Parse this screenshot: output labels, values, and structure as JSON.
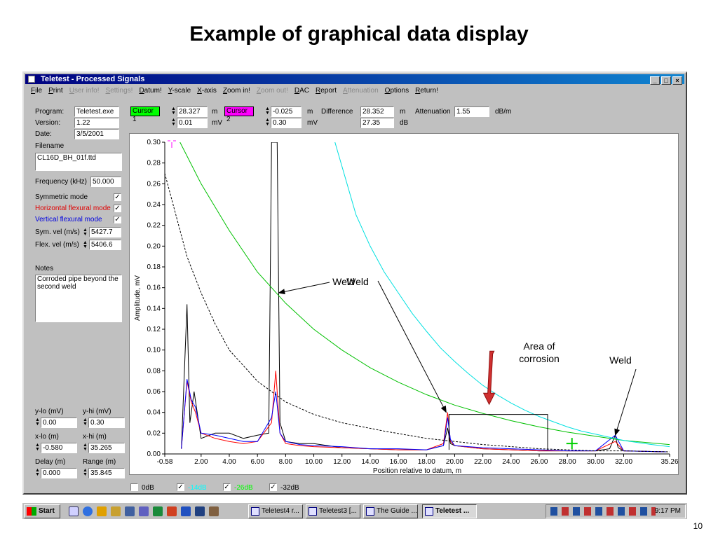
{
  "slide": {
    "title": "Example of graphical data display",
    "number": "10"
  },
  "window": {
    "title": "Teletest - Processed Signals",
    "menu": [
      {
        "label": "File",
        "enabled": true
      },
      {
        "label": "Print",
        "enabled": true
      },
      {
        "label": "User info!",
        "enabled": false
      },
      {
        "label": "Settings!",
        "enabled": false
      },
      {
        "label": "Datum!",
        "enabled": true
      },
      {
        "label": "Y-scale",
        "enabled": true
      },
      {
        "label": "X-axis",
        "enabled": true
      },
      {
        "label": "Zoom in!",
        "enabled": true
      },
      {
        "label": "Zoom out!",
        "enabled": false
      },
      {
        "label": "DAC",
        "enabled": true
      },
      {
        "label": "Report",
        "enabled": true
      },
      {
        "label": "Attenuation",
        "enabled": false
      },
      {
        "label": "Options",
        "enabled": true
      },
      {
        "label": "Return!",
        "enabled": true
      }
    ]
  },
  "info": {
    "program_label": "Program:",
    "program": "Teletest.exe",
    "version_label": "Version:",
    "version": "1.22",
    "date_label": "Date:",
    "date": "3/5/2001",
    "filename_label": "Filename",
    "filename": "CL16D_BH_01f.ttd",
    "frequency_label": "Frequency (kHz)",
    "frequency": "50.000",
    "symmetric_label": "Symmetric mode",
    "horizontal_label": "Horizontal flexural mode",
    "vertical_label": "Vertical flexural mode",
    "check_mark": "✓",
    "sym_vel_label": "Sym. vel (m/s)",
    "sym_vel": "5427.7",
    "flex_vel_label": "Flex. vel (m/s)",
    "flex_vel": "5406.6",
    "notes_label": "Notes",
    "notes": "Corroded pipe beyond the second weld"
  },
  "limits": {
    "ylo_label": "y-lo (mV)",
    "ylo": "0.00",
    "yhi_label": "y-hi (mV)",
    "yhi": "0.30",
    "xlo_label": "x-lo (m)",
    "xlo": "-0.580",
    "xhi_label": "x-hi (m)",
    "xhi": "35.265",
    "delay_label": "Delay (m)",
    "delay": "0.000",
    "range_label": "Range (m)",
    "range": "35.845"
  },
  "cursors": {
    "c1_label": "Cursor 1",
    "c1_color": "#00ff00",
    "c1_pos": "28.327",
    "c1_amp": "0.01",
    "c2_label": "Cursor 2",
    "c2_color": "#ff00ff",
    "c2_pos": "-0.025",
    "c2_amp": "0.30",
    "unit_m": "m",
    "unit_mv": "mV",
    "unit_db": "dB",
    "difference_label": "Difference",
    "difference": "28.352",
    "difference_db": "27.35",
    "attenuation_label": "Attenuation",
    "attenuation": "1.55",
    "attenuation_unit": "dB/m"
  },
  "dac": [
    {
      "label": "0dB",
      "checked": false,
      "color": "#000000"
    },
    {
      "label": "-14dB",
      "checked": true,
      "color": "#00ffff"
    },
    {
      "label": "-26dB",
      "checked": true,
      "color": "#00ff00"
    },
    {
      "label": "-32dB",
      "checked": true,
      "color": "#000000"
    }
  ],
  "chart_data": {
    "type": "line",
    "xlabel": "Position relative to datum, m",
    "ylabel": "Amplitude, mV",
    "xlim": [
      -0.58,
      35.26
    ],
    "ylim": [
      0,
      0.3
    ],
    "xticks": [
      "-0.58",
      "2.00",
      "4.00",
      "6.00",
      "8.00",
      "10.00",
      "12.00",
      "14.00",
      "16.00",
      "18.00",
      "20.00",
      "22.00",
      "24.00",
      "26.00",
      "28.00",
      "30.00",
      "32.00",
      "35.26"
    ],
    "yticks": [
      "0.00",
      "0.02",
      "0.04",
      "0.06",
      "0.08",
      "0.10",
      "0.12",
      "0.14",
      "0.16",
      "0.18",
      "0.20",
      "0.22",
      "0.24",
      "0.26",
      "0.28",
      "0.30"
    ],
    "grid": false,
    "series": [
      {
        "color": "#000000",
        "x": [
          0.6,
          1.0,
          1.2,
          1.5,
          2,
          3,
          4,
          5,
          6,
          6.8,
          7.0,
          7.1,
          7.2,
          7.4,
          7.6,
          8,
          9,
          10,
          11,
          12,
          14,
          16,
          18,
          19.2,
          19.5,
          19.7,
          20,
          22,
          24,
          26,
          28,
          30,
          31,
          31.4,
          31.6,
          32,
          35
        ],
        "y": [
          0.005,
          0.144,
          0.03,
          0.06,
          0.015,
          0.02,
          0.02,
          0.015,
          0.018,
          0.02,
          0.3,
          0.3,
          0.3,
          0.3,
          0.03,
          0.012,
          0.01,
          0.01,
          0.008,
          0.006,
          0.005,
          0.004,
          0.004,
          0.008,
          0.025,
          0.01,
          0.008,
          0.005,
          0.004,
          0.003,
          0.003,
          0.003,
          0.005,
          0.018,
          0.006,
          0.003,
          0.002
        ]
      },
      {
        "color": "#ff0000",
        "x": [
          0.6,
          1.0,
          1.3,
          1.6,
          2,
          3,
          4,
          5,
          6,
          7.0,
          7.3,
          7.6,
          8,
          9,
          10,
          12,
          14,
          16,
          18,
          19.2,
          19.5,
          19.7,
          20,
          22,
          24,
          26,
          28,
          30,
          31.4,
          32,
          35
        ],
        "y": [
          0.005,
          0.07,
          0.05,
          0.04,
          0.02,
          0.015,
          0.012,
          0.01,
          0.012,
          0.03,
          0.08,
          0.02,
          0.01,
          0.008,
          0.007,
          0.006,
          0.005,
          0.004,
          0.004,
          0.01,
          0.04,
          0.012,
          0.008,
          0.005,
          0.004,
          0.003,
          0.003,
          0.003,
          0.012,
          0.003,
          0.002
        ]
      },
      {
        "color": "#0000ff",
        "x": [
          0.6,
          1.0,
          1.3,
          1.6,
          2,
          3,
          4,
          5,
          6,
          7.0,
          7.3,
          7.6,
          8,
          9,
          10,
          12,
          14,
          16,
          18,
          19.2,
          19.5,
          19.7,
          20,
          22,
          24,
          26,
          28,
          30,
          31.4,
          32,
          35
        ],
        "y": [
          0.005,
          0.072,
          0.052,
          0.045,
          0.02,
          0.018,
          0.015,
          0.012,
          0.012,
          0.035,
          0.06,
          0.02,
          0.012,
          0.009,
          0.008,
          0.007,
          0.005,
          0.005,
          0.004,
          0.008,
          0.035,
          0.014,
          0.008,
          0.006,
          0.005,
          0.004,
          0.003,
          0.003,
          0.018,
          0.003,
          0.002
        ]
      },
      {
        "color": "#000000",
        "dash": true,
        "x": [
          -0.58,
          1,
          2,
          3,
          4,
          6,
          8,
          10,
          12,
          15,
          18,
          20,
          22,
          24,
          26,
          28,
          30,
          32,
          35.26
        ],
        "y": [
          0.27,
          0.19,
          0.155,
          0.125,
          0.1,
          0.07,
          0.05,
          0.038,
          0.03,
          0.022,
          0.015,
          0.012,
          0.009,
          0.007,
          0.005,
          0.004,
          0.003,
          0.003,
          0.002
        ]
      },
      {
        "color": "#00c000",
        "x": [
          0.5,
          2,
          4,
          6,
          8,
          10,
          12,
          14,
          16,
          18,
          20,
          22,
          24,
          26,
          28,
          30,
          32,
          35.26
        ],
        "y": [
          0.3,
          0.26,
          0.215,
          0.175,
          0.145,
          0.12,
          0.1,
          0.083,
          0.069,
          0.057,
          0.047,
          0.039,
          0.032,
          0.026,
          0.021,
          0.017,
          0.013,
          0.009
        ]
      },
      {
        "color": "#00e0e0",
        "x": [
          11.5,
          13,
          14,
          15,
          16,
          17,
          18,
          19,
          20,
          21,
          22,
          23,
          24,
          25,
          26,
          27,
          28,
          29,
          30,
          31,
          32,
          33,
          34,
          35.26
        ],
        "y": [
          0.3,
          0.23,
          0.2,
          0.175,
          0.155,
          0.135,
          0.118,
          0.102,
          0.089,
          0.077,
          0.066,
          0.057,
          0.049,
          0.042,
          0.036,
          0.031,
          0.026,
          0.022,
          0.019,
          0.016,
          0.013,
          0.011,
          0.009,
          0.007
        ]
      }
    ],
    "corrosion_box": {
      "x": [
        19.6,
        26.6
      ],
      "y": [
        0.004,
        0.038
      ]
    },
    "cursor1": {
      "x": 28.327,
      "y": 0.01
    },
    "annotations": [
      {
        "text": "Weld",
        "target_x": 7.3,
        "target_y": 0.155
      },
      {
        "text": "Weld",
        "target_x": 19.4,
        "target_y": 0.04
      },
      {
        "text": "Area of\ncorrosion",
        "target_x": 22.3,
        "target_y": 0.045
      },
      {
        "text": "Weld",
        "target_x": 31.4,
        "target_y": 0.018
      }
    ]
  },
  "taskbar": {
    "start": "Start",
    "buttons": [
      "Teletest4 r...",
      "Teletest3 [...",
      "The Guide ...",
      "Teletest ..."
    ],
    "active_index": 3,
    "clock": "9:17 PM"
  }
}
